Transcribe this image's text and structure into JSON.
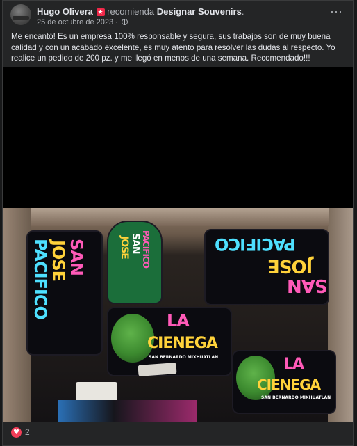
{
  "post": {
    "author": "Hugo Olivera",
    "badge_icon": "star-badge-icon",
    "action": "recomienda",
    "page_name": "Designar Souvenirs",
    "page_suffix": ".",
    "date": "25 de octubre de 2023",
    "separator": "·",
    "privacy_icon": "globe-icon",
    "more_label": "···",
    "body_text": "Me encantó! Es un empresa 100% responsable y segura, sus trabajos son de muy buena calidad y con un acabado excelente, es muy atento para resolver las dudas al respecto. Yo realice un pedido de 200 pz. y me llegó en menos de una semana. Recomendado!!!"
  },
  "photo": {
    "sticker_texts": {
      "san_jose_left_1": "SAN",
      "san_jose_left_2": "JOSE",
      "san_jose_left_3": "PACIFICO",
      "san_jose_center_1": "SAN",
      "san_jose_center_2": "JOSE",
      "san_jose_center_3": "PACIFICO",
      "san_jose_right_1": "SAN",
      "san_jose_right_2": "JOSE",
      "san_jose_right_3": "PACIFICO",
      "cienega_1_a": "LA",
      "cienega_1_b": "CIENEGA",
      "cienega_1_c": "SAN BERNARDO MIXHUATLAN",
      "cienega_2_a": "LA",
      "cienega_2_b": "CIENEGA",
      "cienega_2_c": "SAN BERNARDO MIXHUATLAN"
    }
  },
  "reactions": {
    "icon": "love-reaction-icon",
    "count": "2"
  },
  "colors": {
    "card_bg": "#242526",
    "text": "#e4e6eb",
    "muted": "#b0b3b8",
    "love": "#f33e58"
  }
}
